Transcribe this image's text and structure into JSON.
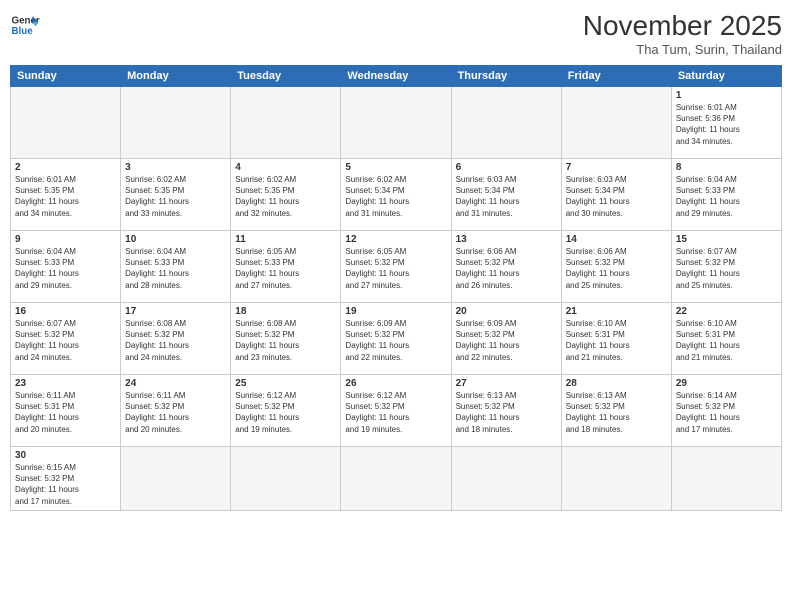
{
  "logo": {
    "line1": "General",
    "line2": "Blue"
  },
  "title": "November 2025",
  "location": "Tha Tum, Surin, Thailand",
  "days_of_week": [
    "Sunday",
    "Monday",
    "Tuesday",
    "Wednesday",
    "Thursday",
    "Friday",
    "Saturday"
  ],
  "weeks": [
    [
      {
        "day": "",
        "info": ""
      },
      {
        "day": "",
        "info": ""
      },
      {
        "day": "",
        "info": ""
      },
      {
        "day": "",
        "info": ""
      },
      {
        "day": "",
        "info": ""
      },
      {
        "day": "",
        "info": ""
      },
      {
        "day": "1",
        "info": "Sunrise: 6:01 AM\nSunset: 5:36 PM\nDaylight: 11 hours\nand 34 minutes."
      }
    ],
    [
      {
        "day": "2",
        "info": "Sunrise: 6:01 AM\nSunset: 5:35 PM\nDaylight: 11 hours\nand 34 minutes."
      },
      {
        "day": "3",
        "info": "Sunrise: 6:02 AM\nSunset: 5:35 PM\nDaylight: 11 hours\nand 33 minutes."
      },
      {
        "day": "4",
        "info": "Sunrise: 6:02 AM\nSunset: 5:35 PM\nDaylight: 11 hours\nand 32 minutes."
      },
      {
        "day": "5",
        "info": "Sunrise: 6:02 AM\nSunset: 5:34 PM\nDaylight: 11 hours\nand 31 minutes."
      },
      {
        "day": "6",
        "info": "Sunrise: 6:03 AM\nSunset: 5:34 PM\nDaylight: 11 hours\nand 31 minutes."
      },
      {
        "day": "7",
        "info": "Sunrise: 6:03 AM\nSunset: 5:34 PM\nDaylight: 11 hours\nand 30 minutes."
      },
      {
        "day": "8",
        "info": "Sunrise: 6:04 AM\nSunset: 5:33 PM\nDaylight: 11 hours\nand 29 minutes."
      }
    ],
    [
      {
        "day": "9",
        "info": "Sunrise: 6:04 AM\nSunset: 5:33 PM\nDaylight: 11 hours\nand 29 minutes."
      },
      {
        "day": "10",
        "info": "Sunrise: 6:04 AM\nSunset: 5:33 PM\nDaylight: 11 hours\nand 28 minutes."
      },
      {
        "day": "11",
        "info": "Sunrise: 6:05 AM\nSunset: 5:33 PM\nDaylight: 11 hours\nand 27 minutes."
      },
      {
        "day": "12",
        "info": "Sunrise: 6:05 AM\nSunset: 5:32 PM\nDaylight: 11 hours\nand 27 minutes."
      },
      {
        "day": "13",
        "info": "Sunrise: 6:06 AM\nSunset: 5:32 PM\nDaylight: 11 hours\nand 26 minutes."
      },
      {
        "day": "14",
        "info": "Sunrise: 6:06 AM\nSunset: 5:32 PM\nDaylight: 11 hours\nand 25 minutes."
      },
      {
        "day": "15",
        "info": "Sunrise: 6:07 AM\nSunset: 5:32 PM\nDaylight: 11 hours\nand 25 minutes."
      }
    ],
    [
      {
        "day": "16",
        "info": "Sunrise: 6:07 AM\nSunset: 5:32 PM\nDaylight: 11 hours\nand 24 minutes."
      },
      {
        "day": "17",
        "info": "Sunrise: 6:08 AM\nSunset: 5:32 PM\nDaylight: 11 hours\nand 24 minutes."
      },
      {
        "day": "18",
        "info": "Sunrise: 6:08 AM\nSunset: 5:32 PM\nDaylight: 11 hours\nand 23 minutes."
      },
      {
        "day": "19",
        "info": "Sunrise: 6:09 AM\nSunset: 5:32 PM\nDaylight: 11 hours\nand 22 minutes."
      },
      {
        "day": "20",
        "info": "Sunrise: 6:09 AM\nSunset: 5:32 PM\nDaylight: 11 hours\nand 22 minutes."
      },
      {
        "day": "21",
        "info": "Sunrise: 6:10 AM\nSunset: 5:31 PM\nDaylight: 11 hours\nand 21 minutes."
      },
      {
        "day": "22",
        "info": "Sunrise: 6:10 AM\nSunset: 5:31 PM\nDaylight: 11 hours\nand 21 minutes."
      }
    ],
    [
      {
        "day": "23",
        "info": "Sunrise: 6:11 AM\nSunset: 5:31 PM\nDaylight: 11 hours\nand 20 minutes."
      },
      {
        "day": "24",
        "info": "Sunrise: 6:11 AM\nSunset: 5:32 PM\nDaylight: 11 hours\nand 20 minutes."
      },
      {
        "day": "25",
        "info": "Sunrise: 6:12 AM\nSunset: 5:32 PM\nDaylight: 11 hours\nand 19 minutes."
      },
      {
        "day": "26",
        "info": "Sunrise: 6:12 AM\nSunset: 5:32 PM\nDaylight: 11 hours\nand 19 minutes."
      },
      {
        "day": "27",
        "info": "Sunrise: 6:13 AM\nSunset: 5:32 PM\nDaylight: 11 hours\nand 18 minutes."
      },
      {
        "day": "28",
        "info": "Sunrise: 6:13 AM\nSunset: 5:32 PM\nDaylight: 11 hours\nand 18 minutes."
      },
      {
        "day": "29",
        "info": "Sunrise: 6:14 AM\nSunset: 5:32 PM\nDaylight: 11 hours\nand 17 minutes."
      }
    ],
    [
      {
        "day": "30",
        "info": "Sunrise: 6:15 AM\nSunset: 5:32 PM\nDaylight: 11 hours\nand 17 minutes."
      },
      {
        "day": "",
        "info": ""
      },
      {
        "day": "",
        "info": ""
      },
      {
        "day": "",
        "info": ""
      },
      {
        "day": "",
        "info": ""
      },
      {
        "day": "",
        "info": ""
      },
      {
        "day": "",
        "info": ""
      }
    ]
  ]
}
